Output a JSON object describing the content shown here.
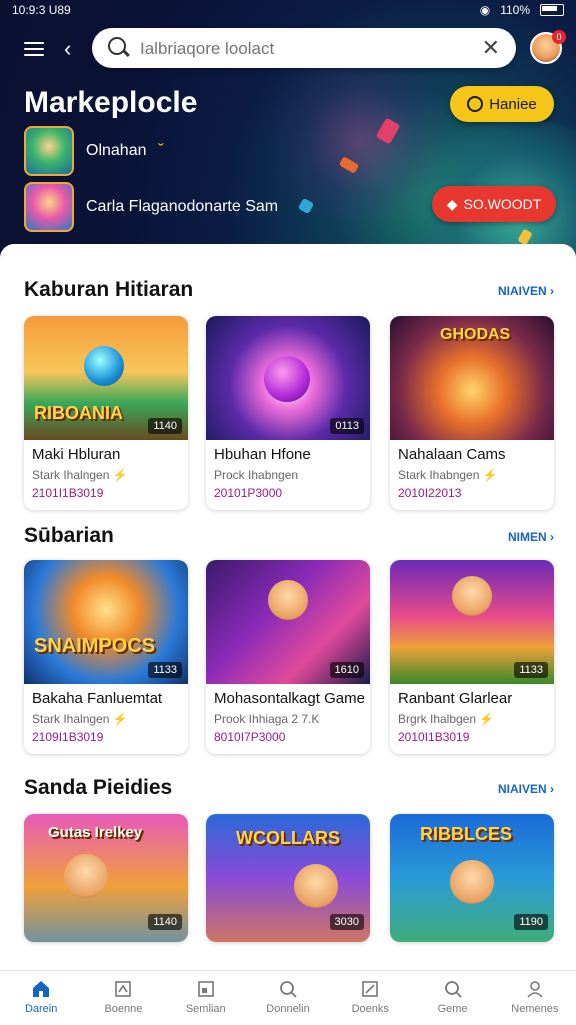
{
  "status_bar": {
    "time": "10:9:3 U89",
    "battery": "110%"
  },
  "search": {
    "placeholder": "Ialbriaqore loolact"
  },
  "avatar_badge": "0",
  "hero": {
    "title": "Markeplocle",
    "action_label": "Haniee",
    "row1": {
      "label": "Olnahan",
      "suffix": "˘"
    },
    "row2": {
      "label": "Carla Flaganodonarte Sam"
    },
    "red_action": "SO.WOODT"
  },
  "sections": [
    {
      "title": "Kaburan Hitiaran",
      "more": "NIAIVEN",
      "cards": [
        {
          "image_label": "RIBOANIA",
          "duration": "1140",
          "title": "Maki Hbluran",
          "sub": "Stark Ihalngen",
          "date": "2101I1B3019"
        },
        {
          "image_label": "",
          "duration": "0113",
          "title": "Hbuhan Hfone",
          "sub": "Prock Ihabngen",
          "date": "20101P3000"
        },
        {
          "image_label": "GHODAS",
          "duration": "",
          "title": "Nahalaan Cams",
          "sub": "Stark Ihabngen",
          "date": "2010I22013"
        }
      ]
    },
    {
      "title": "Sūbarian",
      "more": "NIMEN",
      "cards": [
        {
          "image_label": "SNAIMPOCS",
          "duration": "1133",
          "title": "Bakaha Fanluemtat",
          "sub": "Stark Ihalngen",
          "date": "2109I1B3019"
        },
        {
          "image_label": "",
          "duration": "1610",
          "title": "Mohasontalkagt Game",
          "sub": "Prook Ihhiaga 2 7.K",
          "date": "8010I7P3000"
        },
        {
          "image_label": "",
          "duration": "1133",
          "title": "Ranbant Glarlear",
          "sub": "Brgrk Ihalbgen",
          "date": "2010I1B3019"
        }
      ]
    },
    {
      "title": "Sanda Pieidies",
      "more": "NIAIVEN",
      "cards": [
        {
          "image_label": "Gutas Irelkey",
          "duration": "1140",
          "title": "",
          "sub": "",
          "date": ""
        },
        {
          "image_label": "WCOLLARS",
          "duration": "3030",
          "title": "",
          "sub": "",
          "date": ""
        },
        {
          "image_label": "RIBBLCES",
          "duration": "1190",
          "title": "",
          "sub": "",
          "date": ""
        }
      ]
    }
  ],
  "nav": [
    {
      "label": "Darein",
      "icon": "home-icon"
    },
    {
      "label": "Boenne",
      "icon": "puzzle-icon"
    },
    {
      "label": "Semlian",
      "icon": "image-icon"
    },
    {
      "label": "Donnelin",
      "icon": "search-icon"
    },
    {
      "label": "Doenks",
      "icon": "tag-icon"
    },
    {
      "label": "Geme",
      "icon": "search-icon"
    },
    {
      "label": "Nemenes",
      "icon": "person-icon"
    }
  ],
  "colors": {
    "accent": "#1565c0",
    "yellow": "#f5c518",
    "red": "#e8372f",
    "hero_bg": "#0a1236"
  }
}
